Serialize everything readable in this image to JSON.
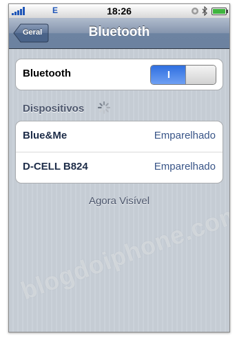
{
  "statusbar": {
    "carrier": "E",
    "time": "18:26",
    "signal_icon": "signal-bars-icon",
    "lock_icon": "rotation-lock-icon",
    "bluetooth_icon": "bluetooth-icon",
    "battery_icon": "battery-icon",
    "battery_level": 1.0
  },
  "navbar": {
    "back_label": "Geral",
    "title": "Bluetooth"
  },
  "bluetooth_row": {
    "label": "Bluetooth",
    "toggle_label": "I",
    "enabled": true
  },
  "devices_section": {
    "title": "Dispositivos",
    "spinner_icon": "activity-spinner-icon",
    "devices": [
      {
        "name": "Blue&Me",
        "status": "Emparelhado"
      },
      {
        "name": "D-CELL B824",
        "status": "Emparelhado"
      }
    ]
  },
  "footer": {
    "visibility": "Agora Visível"
  },
  "watermark": "blogdoiphone.com",
  "colors": {
    "nav_bar": "#6d83a1",
    "toggle_on": "#2f6fe0",
    "value_text": "#385487",
    "background": "#c5ccd4"
  }
}
